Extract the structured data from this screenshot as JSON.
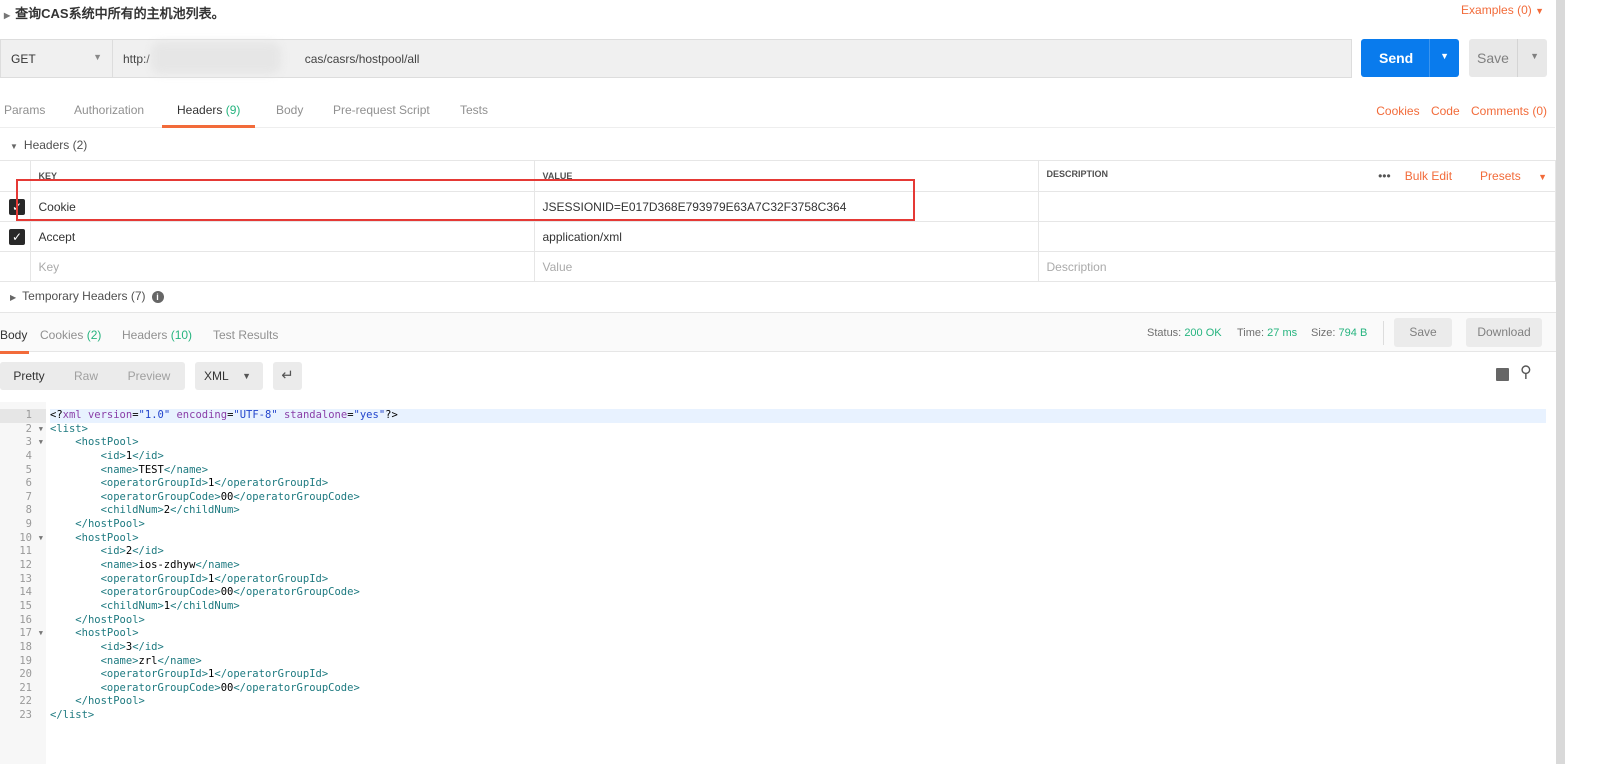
{
  "request": {
    "title": "查询CAS系统中所有的主机池列表。",
    "examples_label": "Examples (0)",
    "method": "GET",
    "url_prefix": "http:/",
    "url_suffix": "cas/casrs/hostpool/all",
    "send_label": "Send",
    "save_label": "Save"
  },
  "tabs": [
    {
      "label": "Params"
    },
    {
      "label": "Authorization"
    },
    {
      "label": "Headers",
      "count": "(9)"
    },
    {
      "label": "Body"
    },
    {
      "label": "Pre-request Script"
    },
    {
      "label": "Tests"
    }
  ],
  "right_links": {
    "cookies": "Cookies",
    "code": "Code",
    "comments": "Comments (0)"
  },
  "headers_section": {
    "title": "Headers (2)",
    "columns": {
      "key": "KEY",
      "value": "VALUE",
      "description": "DESCRIPTION"
    },
    "more": "•••",
    "bulk_edit": "Bulk Edit",
    "presets": "Presets",
    "rows": [
      {
        "key": "Cookie",
        "value": "JSESSIONID=E017D368E793979E63A7C32F3758C364",
        "description": "",
        "checked": true
      },
      {
        "key": "Accept",
        "value": "application/xml",
        "description": "",
        "checked": true
      }
    ],
    "placeholders": {
      "key": "Key",
      "value": "Value",
      "description": "Description"
    },
    "temporary": "Temporary Headers (7)"
  },
  "response": {
    "tabs": [
      {
        "label": "Body"
      },
      {
        "label": "Cookies",
        "count": "(2)"
      },
      {
        "label": "Headers",
        "count": "(10)"
      },
      {
        "label": "Test Results"
      }
    ],
    "status_label": "Status:",
    "status": "200 OK",
    "time_label": "Time:",
    "time": "27 ms",
    "size_label": "Size:",
    "size": "794 B",
    "save": "Save",
    "download": "Download",
    "views": {
      "pretty": "Pretty",
      "raw": "Raw",
      "preview": "Preview",
      "format": "XML"
    },
    "code_lines": [
      "<?xml version=\"1.0\" encoding=\"UTF-8\" standalone=\"yes\"?>",
      "<list>",
      "    <hostPool>",
      "        <id>1</id>",
      "        <name>TEST</name>",
      "        <operatorGroupId>1</operatorGroupId>",
      "        <operatorGroupCode>00</operatorGroupCode>",
      "        <childNum>2</childNum>",
      "    </hostPool>",
      "    <hostPool>",
      "        <id>2</id>",
      "        <name>ios-zdhyw</name>",
      "        <operatorGroupId>1</operatorGroupId>",
      "        <operatorGroupCode>00</operatorGroupCode>",
      "        <childNum>1</childNum>",
      "    </hostPool>",
      "    <hostPool>",
      "        <id>3</id>",
      "        <name>zrl</name>",
      "        <operatorGroupId>1</operatorGroupId>",
      "        <operatorGroupCode>00</operatorGroupCode>",
      "    </hostPool>",
      "</list>"
    ],
    "fold_lines": [
      2,
      3,
      10,
      17
    ]
  }
}
